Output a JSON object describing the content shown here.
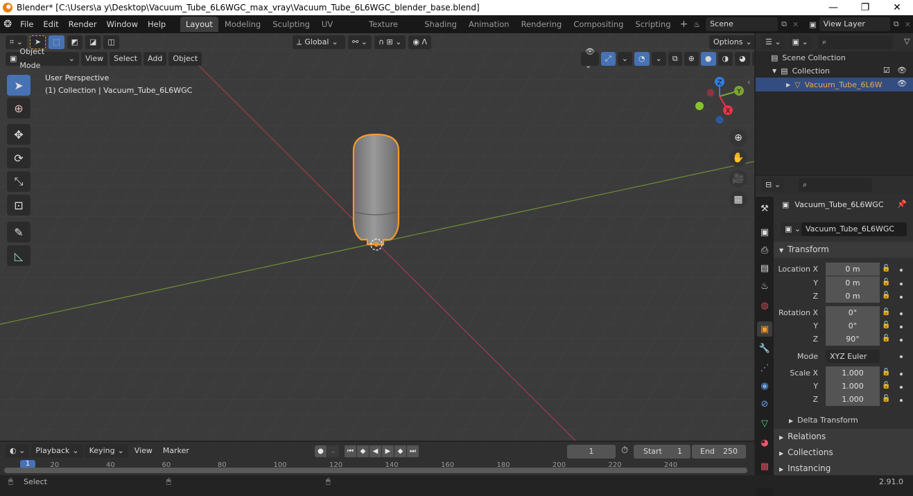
{
  "window": {
    "title": "Blender* [C:\\Users\\a y\\Desktop\\Vacuum_Tube_6L6WGC_max_vray\\Vacuum_Tube_6L6WGC_blender_base.blend]",
    "minimize": "—",
    "maximize": "❐",
    "close": "✕"
  },
  "menu": [
    "File",
    "Edit",
    "Render",
    "Window",
    "Help"
  ],
  "workspaces": [
    "Layout",
    "Modeling",
    "Sculpting",
    "UV Editing",
    "Texture Paint",
    "Shading",
    "Animation",
    "Rendering",
    "Compositing",
    "Scripting"
  ],
  "active_workspace": "Layout",
  "scene": {
    "label": "Scene",
    "view_layer": "View Layer"
  },
  "viewport": {
    "header": {
      "mode": "Object Mode",
      "menus": [
        "View",
        "Select",
        "Add",
        "Object"
      ],
      "orientation": "Global",
      "options": "Options"
    },
    "overlay_text": {
      "perspective": "User Perspective",
      "collection": "(1) Collection | Vacuum_Tube_6L6WGC"
    },
    "gizmo": {
      "x": "X",
      "y": "Y",
      "z": "Z"
    },
    "colors": {
      "x": "#e8334a",
      "y": "#7ba433",
      "z": "#2f7fe8",
      "select": "#f59c2b",
      "active_tool": "#4772b3"
    }
  },
  "outliner": {
    "items": [
      {
        "label": "Scene Collection"
      },
      {
        "label": "Collection"
      },
      {
        "label": "Vacuum_Tube_6L6W"
      }
    ]
  },
  "properties": {
    "object_name": "Vacuum_Tube_6L6WGC",
    "name_field": "Vacuum_Tube_6L6WGC",
    "transform_label": "Transform",
    "location": {
      "label": "Location X",
      "x": "0 m",
      "y": "0 m",
      "z": "0 m"
    },
    "rotation": {
      "label": "Rotation X",
      "x": "0°",
      "y": "0°",
      "z": "90°"
    },
    "mode": {
      "label": "Mode",
      "value": "XYZ Euler"
    },
    "scale": {
      "label": "Scale X",
      "x": "1.000",
      "y": "1.000",
      "z": "1.000"
    },
    "axis_y": "Y",
    "axis_z": "Z",
    "sections": [
      "Delta Transform",
      "Relations",
      "Collections",
      "Instancing"
    ]
  },
  "timeline": {
    "menus": [
      "Playback",
      "Keying",
      "View",
      "Marker"
    ],
    "current_frame": "1",
    "start_label": "Start",
    "start": "1",
    "end_label": "End",
    "end": "250",
    "ticks": [
      "1",
      "20",
      "40",
      "60",
      "80",
      "100",
      "120",
      "140",
      "160",
      "180",
      "200",
      "220",
      "240"
    ]
  },
  "status": {
    "select": "Select",
    "version": "2.91.0"
  }
}
